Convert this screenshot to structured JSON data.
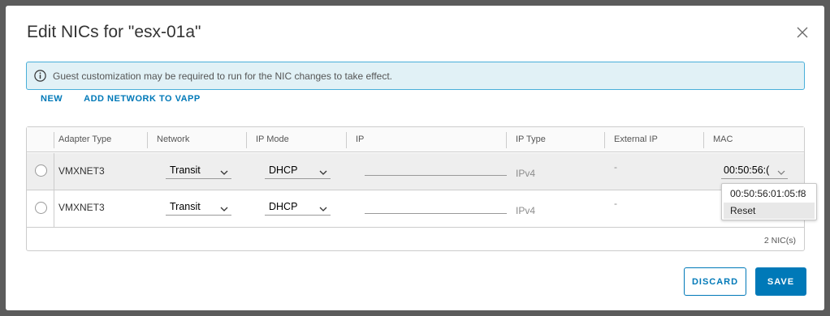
{
  "dialog": {
    "title": "Edit NICs for \"esx-01a\"",
    "close_icon": "close-icon"
  },
  "alert": {
    "icon": "info-icon",
    "text": "Guest customization may be required to run for the NIC changes to take effect."
  },
  "actions": {
    "new_label": "NEW",
    "add_network_label": "ADD NETWORK TO VAPP"
  },
  "grid": {
    "columns": [
      "Adapter Type",
      "Network",
      "IP Mode",
      "IP",
      "IP Type",
      "External IP",
      "MAC"
    ],
    "rows": [
      {
        "adapter_type": "VMXNET3",
        "network": "Transit",
        "ip_mode": "DHCP",
        "ip": "",
        "ip_type": "IPv4",
        "external_ip": "-",
        "mac": "00:50:56:("
      },
      {
        "adapter_type": "VMXNET3",
        "network": "Transit",
        "ip_mode": "DHCP",
        "ip": "",
        "ip_type": "IPv4",
        "external_ip": "-",
        "mac": ""
      }
    ],
    "footer_count": "2 NIC(s)"
  },
  "mac_dropdown": {
    "options": [
      "00:50:56:01:05:f8",
      "Reset"
    ]
  },
  "buttons": {
    "discard_label": "DISCARD",
    "save_label": "SAVE"
  },
  "colors": {
    "accent": "#0079b8",
    "alert_bg": "#e1f1f6",
    "alert_border": "#49afd9"
  }
}
